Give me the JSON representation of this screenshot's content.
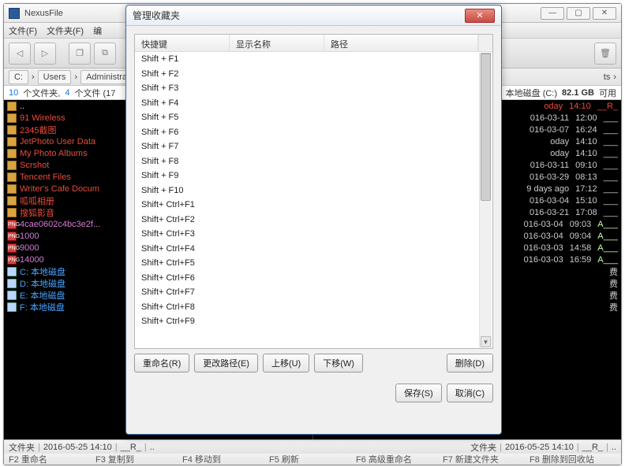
{
  "main": {
    "title": "NexusFile",
    "window_buttons": {
      "min": "—",
      "max": "▢",
      "close": "✕"
    }
  },
  "menu": {
    "file": "文件(F)",
    "folder": "文件夹(F)",
    "edit": "编"
  },
  "toolbar_icons": {
    "back": "◁",
    "forward": "▷",
    "copy": "❐",
    "layers": "⧉",
    "trash": "🗑"
  },
  "breadcrumb": {
    "drive": "C:",
    "users": "Users",
    "admin": "Administra",
    "right_tail": "ts"
  },
  "stats": {
    "folders_count": "10",
    "folders_label": "个文件夹,",
    "files_count": "4",
    "files_label": "个文件 (17",
    "drive_label": "本地磁盘 (C:)",
    "drive_free": "82.1 GB",
    "drive_free_label": "可用"
  },
  "left_pane": {
    "up": "..",
    "items": [
      {
        "type": "folder",
        "label": "91 Wireless"
      },
      {
        "type": "folder",
        "label": "2345截图"
      },
      {
        "type": "folder",
        "label": "JetPhoto User Data"
      },
      {
        "type": "folder",
        "label": "My Photo Albums"
      },
      {
        "type": "folder",
        "label": "Scrshot"
      },
      {
        "type": "folder",
        "label": "Tencent Files"
      },
      {
        "type": "folder",
        "label": "Writer's Cafe Docum"
      },
      {
        "type": "folder",
        "label": "呱呱相册"
      },
      {
        "type": "folder",
        "label": "搜狐影音"
      },
      {
        "type": "png",
        "label": "4cae0602c4bc3e2f..."
      },
      {
        "type": "png",
        "label": "1000"
      },
      {
        "type": "png",
        "label": "9000"
      },
      {
        "type": "png",
        "label": "14000"
      },
      {
        "type": "drive",
        "label": "C: 本地磁盘"
      },
      {
        "type": "drive",
        "label": "D: 本地磁盘"
      },
      {
        "type": "drive",
        "label": "E: 本地磁盘"
      },
      {
        "type": "drive",
        "label": "F: 本地磁盘"
      }
    ]
  },
  "right_pane": {
    "rows": [
      {
        "date": "oday",
        "time": "14:10",
        "attr": "__R_",
        "today": true
      },
      {
        "date": "016-03-11",
        "time": "12:00",
        "attr": "___"
      },
      {
        "date": "016-03-07",
        "time": "16:24",
        "attr": "___"
      },
      {
        "date": "oday",
        "time": "14:10",
        "attr": "___"
      },
      {
        "date": "oday",
        "time": "14:10",
        "attr": "___"
      },
      {
        "date": "016-03-11",
        "time": "09:10",
        "attr": "___"
      },
      {
        "date": "016-03-29",
        "time": "08:13",
        "attr": "___"
      },
      {
        "date": "9 days ago",
        "time": "17:12",
        "attr": "___"
      },
      {
        "date": "016-03-04",
        "time": "15:10",
        "attr": "___"
      },
      {
        "date": "016-03-21",
        "time": "17:08",
        "attr": "___"
      },
      {
        "date": "016-03-04",
        "time": "09:03",
        "attr": "A___",
        "a": true
      },
      {
        "date": "016-03-04",
        "time": "09:04",
        "attr": "A___",
        "a": true
      },
      {
        "date": "016-03-03",
        "time": "14:58",
        "attr": "A___",
        "a": true
      },
      {
        "date": "016-03-03",
        "time": "16:59",
        "attr": "A___",
        "a": true
      }
    ],
    "drives": [
      "费",
      "费",
      "费",
      "费"
    ]
  },
  "dialog": {
    "title": "管理收藏夹",
    "header": {
      "shortcut": "快捷键",
      "display_name": "显示名称",
      "path": "路径"
    },
    "rows": [
      "Shift + F1",
      "Shift + F2",
      "Shift + F3",
      "Shift + F4",
      "Shift + F5",
      "Shift + F6",
      "Shift + F7",
      "Shift + F8",
      "Shift + F9",
      "Shift + F10",
      "Shift+ Ctrl+F1",
      "Shift+ Ctrl+F2",
      "Shift+ Ctrl+F3",
      "Shift+ Ctrl+F4",
      "Shift+ Ctrl+F5",
      "Shift+ Ctrl+F6",
      "Shift+ Ctrl+F7",
      "Shift+ Ctrl+F8",
      "Shift+ Ctrl+F9"
    ],
    "buttons": {
      "rename": "重命名(R)",
      "change_path": "更改路径(E)",
      "move_up": "上移(U)",
      "move_down": "下移(W)",
      "delete": "删除(D)",
      "save": "保存(S)",
      "cancel": "取消(C)"
    }
  },
  "statusbar": {
    "left": {
      "folder": "文件夹",
      "date": "2016-05-25 14:10",
      "attr": "__R_",
      "dots": ".."
    },
    "right": {
      "folder": "文件夹",
      "date": "2016-05-25 14:10",
      "attr": "__R_",
      "dots": ".."
    }
  },
  "fnbar": {
    "f2": "F2   重命名",
    "f3": "F3   复制到",
    "f4": "F4   移动到",
    "f5": "F5   刷新",
    "f6": "F6   高级重命名",
    "f7": "F7   新建文件夹",
    "f8": "F8   删除到回收站"
  }
}
